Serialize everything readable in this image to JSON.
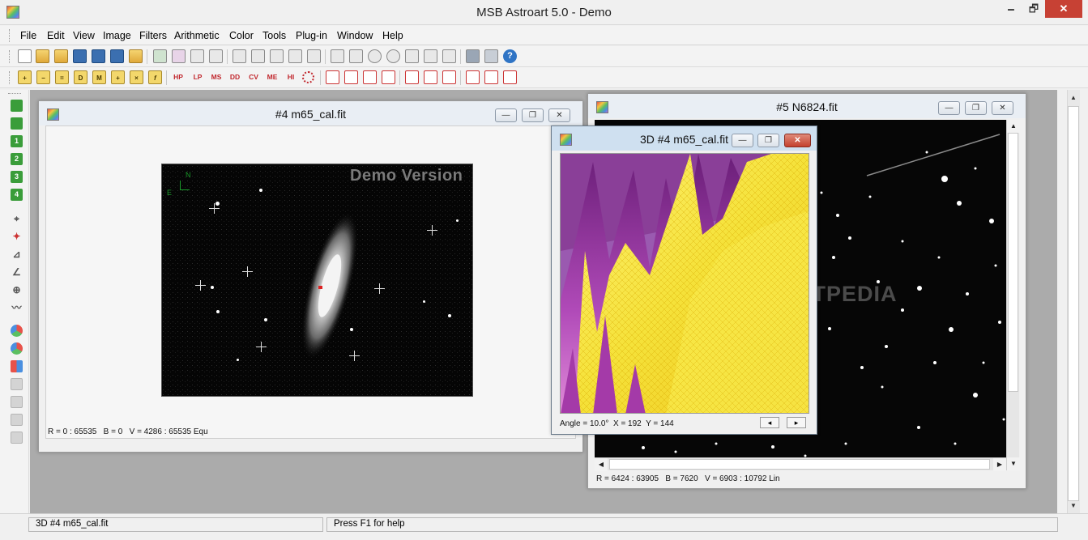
{
  "app": {
    "title": "MSB Astroart 5.0 - Demo",
    "caption": {
      "minimize": "🗕",
      "maximize": "🗗",
      "close": "✕"
    }
  },
  "menu": [
    "File",
    "Edit",
    "View",
    "Image",
    "Filters",
    "Arithmetic",
    "Color",
    "Tools",
    "Plug-in",
    "Window",
    "Help"
  ],
  "toolbar2": {
    "text_buttons": [
      "D",
      "M",
      "f",
      "HP",
      "LP",
      "MS",
      "DD",
      "CV",
      "ME",
      "HI"
    ]
  },
  "left_toolbar": {
    "green_buttons": [
      "",
      "",
      "1",
      "2",
      "3",
      "4"
    ]
  },
  "windows": {
    "m65": {
      "title": "#4 m65_cal.fit",
      "watermark": "Demo Version",
      "compass_n": "N",
      "compass_e": "E",
      "status": "R = 0 : 65535   B = 0   V = 4286 : 65535 Equ",
      "buttons": {
        "minimize": "—",
        "maximize": "❐",
        "close": "✕"
      }
    },
    "n6824": {
      "title": "#5 N6824.fit",
      "status": "R = 6424 : 63905   B = 7620   V = 6903 : 10792 Lin",
      "buttons": {
        "minimize": "—",
        "maximize": "❐",
        "close": "✕"
      },
      "watermark": "SOFTPEDIA"
    },
    "plot3d": {
      "title": "3D #4 m65_cal.fit",
      "status": "Angle = 10.0°  X = 192  Y = 144",
      "buttons": {
        "minimize": "—",
        "maximize": "❐",
        "close": "✕"
      },
      "nav_left": "◂",
      "nav_right": "▸"
    }
  },
  "statusbar": {
    "left": "3D #4 m65_cal.fit",
    "right": "Press F1 for help"
  },
  "colors": {
    "accent_close": "#c74134",
    "mdi_background": "#ababab",
    "plot_yellow": "#f5e23a",
    "plot_magenta": "#b04ab8"
  }
}
